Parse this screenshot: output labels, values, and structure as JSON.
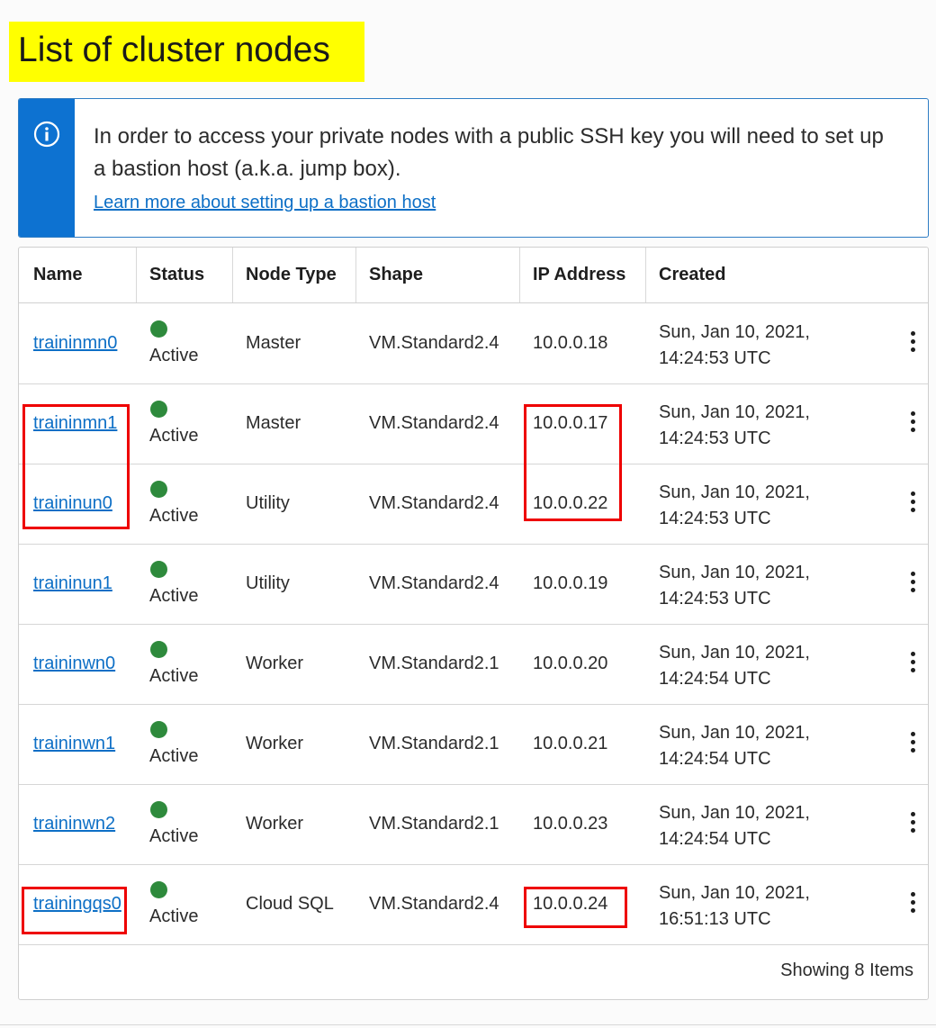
{
  "title": "List of cluster nodes",
  "info": {
    "message": "In order to access your private nodes with a public SSH key you will need to set up a bastion host (a.k.a. jump box).",
    "link": "Learn more about setting up a bastion host",
    "icon": "info-circle-icon"
  },
  "table": {
    "headers": [
      "Name",
      "Status",
      "Node Type",
      "Shape",
      "IP Address",
      "Created"
    ],
    "rows": [
      {
        "name": "traininmn0",
        "status": "Active",
        "type": "Master",
        "shape": "VM.Standard2.4",
        "ip": "10.0.0.18",
        "created_date": "Sun, Jan 10, 2021,",
        "created_time": "14:24:53 UTC"
      },
      {
        "name": "traininmn1",
        "status": "Active",
        "type": "Master",
        "shape": "VM.Standard2.4",
        "ip": "10.0.0.17",
        "created_date": "Sun, Jan 10, 2021,",
        "created_time": "14:24:53 UTC"
      },
      {
        "name": "traininun0",
        "status": "Active",
        "type": "Utility",
        "shape": "VM.Standard2.4",
        "ip": "10.0.0.22",
        "created_date": "Sun, Jan 10, 2021,",
        "created_time": "14:24:53 UTC"
      },
      {
        "name": "traininun1",
        "status": "Active",
        "type": "Utility",
        "shape": "VM.Standard2.4",
        "ip": "10.0.0.19",
        "created_date": "Sun, Jan 10, 2021,",
        "created_time": "14:24:53 UTC"
      },
      {
        "name": "traininwn0",
        "status": "Active",
        "type": "Worker",
        "shape": "VM.Standard2.1",
        "ip": "10.0.0.20",
        "created_date": "Sun, Jan 10, 2021,",
        "created_time": "14:24:54 UTC"
      },
      {
        "name": "traininwn1",
        "status": "Active",
        "type": "Worker",
        "shape": "VM.Standard2.1",
        "ip": "10.0.0.21",
        "created_date": "Sun, Jan 10, 2021,",
        "created_time": "14:24:54 UTC"
      },
      {
        "name": "traininwn2",
        "status": "Active",
        "type": "Worker",
        "shape": "VM.Standard2.1",
        "ip": "10.0.0.23",
        "created_date": "Sun, Jan 10, 2021,",
        "created_time": "14:24:54 UTC"
      },
      {
        "name": "trainingqs0",
        "status": "Active",
        "type": "Cloud SQL",
        "shape": "VM.Standard2.4",
        "ip": "10.0.0.24",
        "created_date": "Sun, Jan 10, 2021,",
        "created_time": "16:51:13 UTC"
      }
    ],
    "footer": "Showing 8 Items"
  },
  "colors": {
    "title_highlight": "#ffff00",
    "info_accent": "#0d72d1",
    "link": "#0d6fc6",
    "status_active": "#2e8a3c",
    "annotation": "#ee0000"
  }
}
